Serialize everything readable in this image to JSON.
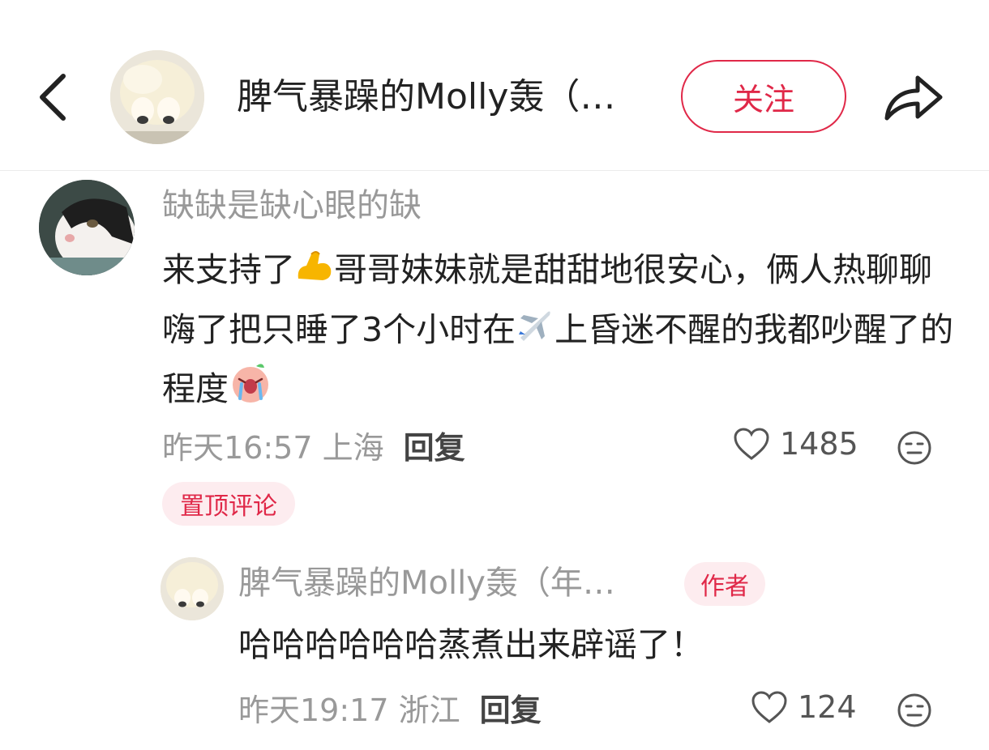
{
  "header": {
    "author_name": "脾气暴躁的Molly轰（…",
    "follow_label": "关注"
  },
  "comment1": {
    "username": "缺缺是缺心眼的缺",
    "text_a": "来支持了",
    "text_b": "哥哥妹妹就是甜甜地很安心，俩人热聊聊嗨了把只睡了3个小时在",
    "text_c": "上昏迷不醒的我都吵醒了的程度",
    "timestamp": "昨天16:57 上海",
    "reply_label": "回复",
    "like_count": "1485",
    "pinned_label": "置顶评论"
  },
  "comment2": {
    "username": "脾气暴躁的Molly轰（年…",
    "author_badge": "作者",
    "text": "哈哈哈哈哈哈蒸煮出来辟谣了！",
    "timestamp": "昨天19:17 浙江",
    "reply_label": "回复",
    "like_count": "124"
  },
  "colors": {
    "accent": "#e02848",
    "badge_bg": "#fdecef",
    "meta_text": "#999999",
    "body_text": "#222222"
  }
}
